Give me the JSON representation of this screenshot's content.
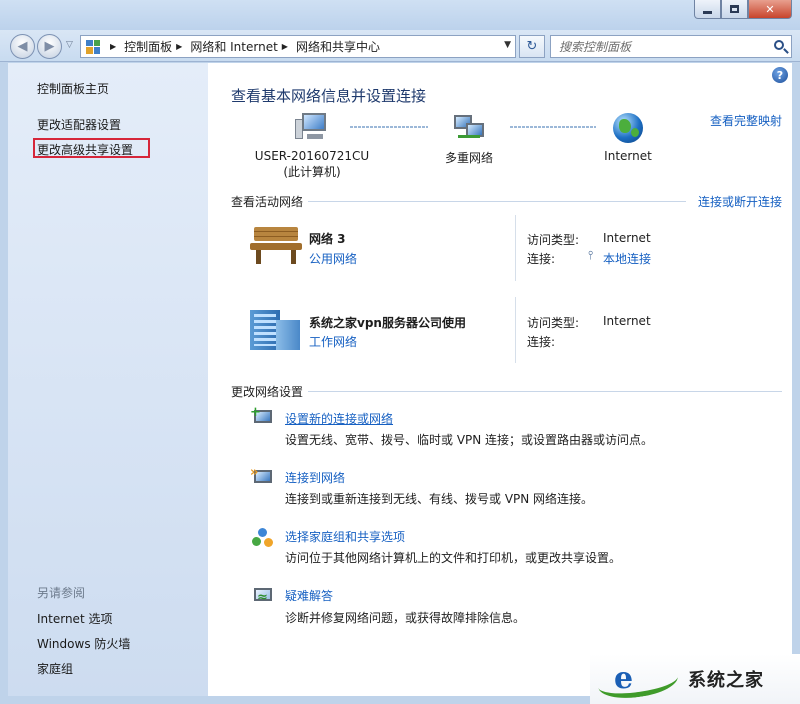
{
  "window": {
    "min_label": "",
    "max_label": "",
    "close_label": "✕"
  },
  "nav": {
    "breadcrumb": [
      "控制面板",
      "网络和 Internet",
      "网络和共享中心"
    ],
    "search_placeholder": "搜索控制面板"
  },
  "sidebar": {
    "items": [
      {
        "label": "控制面板主页"
      },
      {
        "label": "更改适配器设置"
      },
      {
        "label": "更改高级共享设置"
      }
    ],
    "see_also_title": "另请参阅",
    "see_also": [
      {
        "label": "Internet 选项"
      },
      {
        "label": "Windows 防火墙"
      },
      {
        "label": "家庭组"
      }
    ]
  },
  "main": {
    "help": "?",
    "title": "查看基本网络信息并设置连接",
    "view_full_map": "查看完整映射",
    "map": {
      "computer_line1": "USER-20160721CU",
      "computer_line2": "(此计算机)",
      "network": "多重网络",
      "internet": "Internet"
    },
    "active_title": "查看活动网络",
    "connect_link": "连接或断开连接",
    "networks": [
      {
        "name": "网络  3",
        "category": "公用网络",
        "access_label": "访问类型:",
        "access_value": "Internet",
        "conn_label": "连接:",
        "conn_value": "本地连接"
      },
      {
        "name": "系统之家vpn服务器公司使用",
        "category": "工作网络",
        "access_label": "访问类型:",
        "access_value": "Internet",
        "conn_label": "连接:",
        "conn_value": ""
      }
    ],
    "change_title": "更改网络设置",
    "tasks": [
      {
        "link": "设置新的连接或网络",
        "desc": "设置无线、宽带、拨号、临时或 VPN 连接；或设置路由器或访问点。"
      },
      {
        "link": "连接到网络",
        "desc": "连接到或重新连接到无线、有线、拨号或 VPN 网络连接。"
      },
      {
        "link": "选择家庭组和共享选项",
        "desc": "访问位于其他网络计算机上的文件和打印机，或更改共享设置。"
      },
      {
        "link": "疑难解答",
        "desc": "诊断并修复网络问题，或获得故障排除信息。"
      }
    ]
  },
  "watermark": {
    "text": "系统之家"
  },
  "colors": {
    "link": "#1660c2",
    "title": "#1f3a6d",
    "highlight_border": "#d6263a",
    "sidebar_bg": "#dbe6f5"
  }
}
